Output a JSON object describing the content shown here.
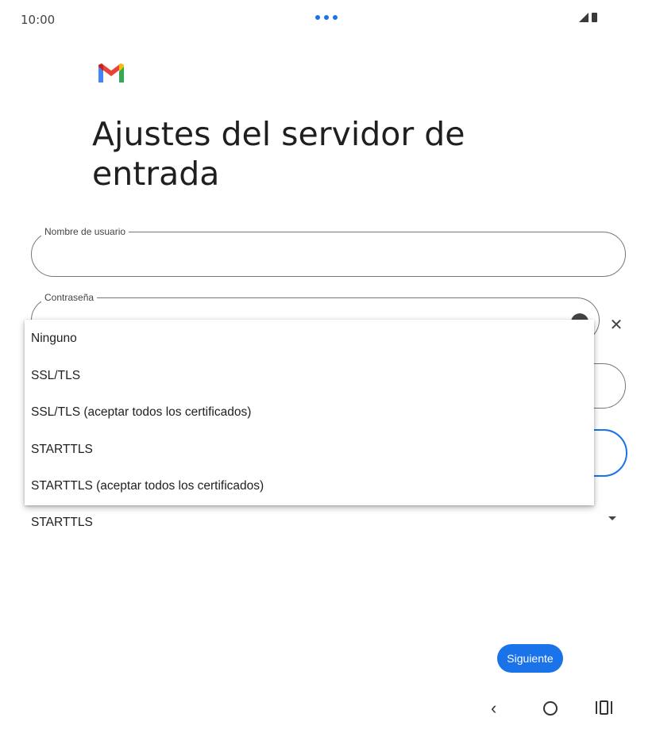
{
  "status_bar": {
    "time": "10:00"
  },
  "page": {
    "title": "Ajustes del servidor de entrada"
  },
  "form": {
    "username_label": "Nombre de usuario",
    "password_label": "Contraseña"
  },
  "security_dropdown": {
    "options": [
      "Ninguno",
      "SSL/TLS",
      "SSL/TLS (aceptar todos los certificados)",
      "STARTTLS",
      "STARTTLS (aceptar todos los certificados)"
    ],
    "selected": "STARTTLS"
  },
  "actions": {
    "next_label": "Siguiente"
  },
  "colors": {
    "accent": "#1a73e8",
    "text": "#1f1f1f",
    "outline": "#747775"
  },
  "icons": [
    "gmail-logo",
    "eye-icon",
    "close-icon",
    "caret-down-icon",
    "back-icon",
    "home-icon",
    "recents-icon"
  ]
}
